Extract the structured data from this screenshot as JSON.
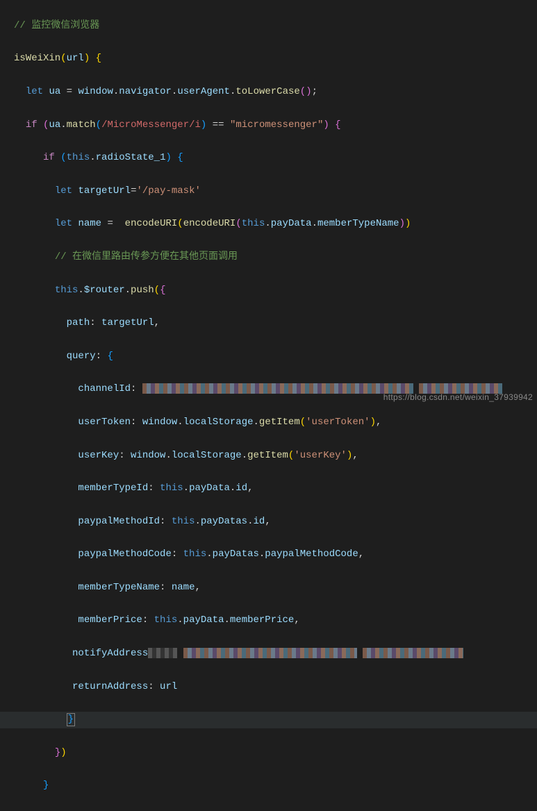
{
  "code": {
    "l1_comment": "// 监控微信浏览器",
    "l2_fn": "isWeiXin",
    "l2_param": "url",
    "l3_let": "let",
    "l3_ua": "ua",
    "l3_window": "window",
    "l3_navigator": "navigator",
    "l3_userAgent": "userAgent",
    "l3_toLowerCase": "toLowerCase",
    "l4_if": "if",
    "l4_match": "match",
    "l4_regex": "/MicroMessenger/i",
    "l4_eq": "==",
    "l4_str": "\"micromessenger\"",
    "l5_if": "if",
    "l5_this": "this",
    "l5_radioState": "radioState_1",
    "l6_let": "let",
    "l6_targetUrl": "targetUrl",
    "l6_str": "'/pay-mask'",
    "l7_let": "let",
    "l7_name": "name",
    "l7_encodeURI": "encodeURI",
    "l7_this": "this",
    "l7_payData": "payData",
    "l7_memberTypeName": "memberTypeName",
    "l8_comment": "// 在微信里路由传参方便在其他页面调用",
    "l9_this": "this",
    "l9_router": "$router",
    "l9_push": "push",
    "l10_path": "path",
    "l10_targetUrl": "targetUrl",
    "l11_query": "query",
    "l12_channelId": "channelId",
    "l13_userToken": "userToken",
    "l13_window": "window",
    "l13_localStorage": "localStorage",
    "l13_getItem": "getItem",
    "l13_str": "'userToken'",
    "l14_userKey": "userKey",
    "l14_str": "'userKey'",
    "l15_memberTypeId": "memberTypeId",
    "l15_this": "this",
    "l15_payData": "payData",
    "l15_id": "id",
    "l16_paypalMethodId": "paypalMethodId",
    "l16_this": "this",
    "l16_payDatas": "payDatas",
    "l16_id": "id",
    "l17_paypalMethodCode": "paypalMethodCode",
    "l17_this": "this",
    "l17_payDatas": "payDatas",
    "l18_memberTypeName": "memberTypeName",
    "l18_name": "name",
    "l19_memberPrice": "memberPrice",
    "l19_this": "this",
    "l19_payData": "payData",
    "l20_notifyAddress": "notifyAddress",
    "l21_returnAddress": "returnAddress",
    "l21_url": "url"
  },
  "watermark": "https://blog.csdn.net/weixin_37939942"
}
